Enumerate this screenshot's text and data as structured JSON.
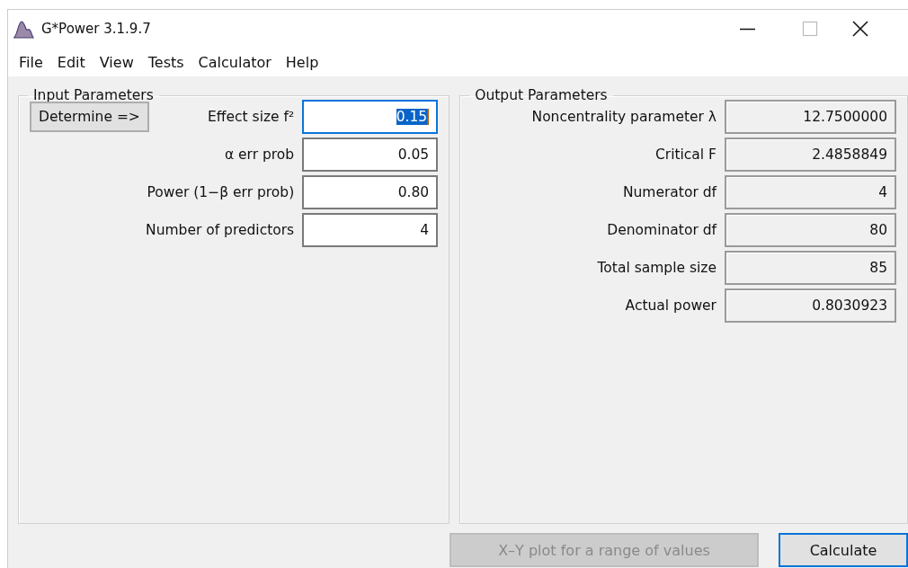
{
  "window": {
    "title": "G*Power 3.1.9.7"
  },
  "menu": [
    {
      "label": "File"
    },
    {
      "label": "Edit"
    },
    {
      "label": "View"
    },
    {
      "label": "Tests"
    },
    {
      "label": "Calculator"
    },
    {
      "label": "Help"
    }
  ],
  "input_parameters": {
    "title": "Input Parameters",
    "determine_button": "Determine =>",
    "fields": [
      {
        "label": "Effect size f²",
        "value": "0.15",
        "focused": true
      },
      {
        "label": "α err prob",
        "value": "0.05",
        "focused": false
      },
      {
        "label": "Power (1−β err prob)",
        "value": "0.80",
        "focused": false
      },
      {
        "label": "Number of predictors",
        "value": "4",
        "focused": false
      }
    ]
  },
  "output_parameters": {
    "title": "Output Parameters",
    "fields": [
      {
        "label": "Noncentrality parameter λ",
        "value": "12.7500000"
      },
      {
        "label": "Critical F",
        "value": "2.4858849"
      },
      {
        "label": "Numerator df",
        "value": "4"
      },
      {
        "label": "Denominator df",
        "value": "80"
      },
      {
        "label": "Total sample size",
        "value": "85"
      },
      {
        "label": "Actual power",
        "value": "0.8030923"
      }
    ]
  },
  "buttons": [
    {
      "label": "X–Y plot for a range of values",
      "disabled": true,
      "focused": false
    },
    {
      "label": "Calculate",
      "disabled": false,
      "focused": true
    }
  ]
}
